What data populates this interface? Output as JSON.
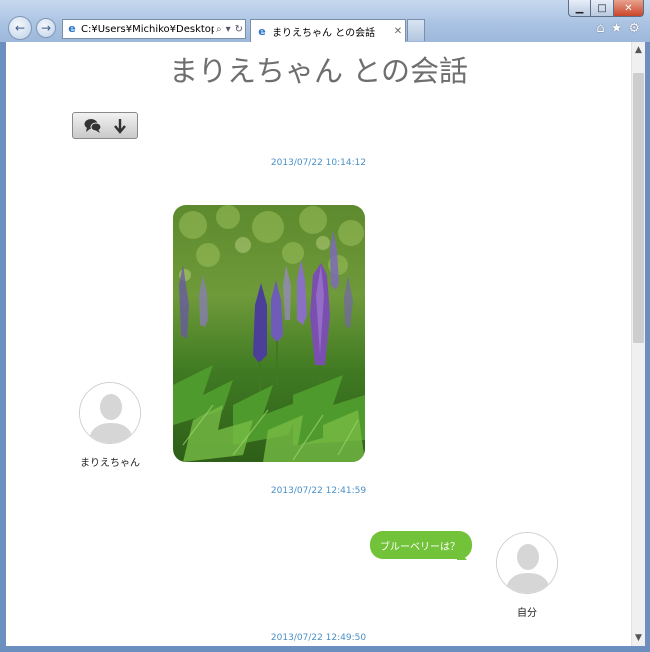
{
  "browser": {
    "address": "C:¥Users¥Michiko¥Desktop¥",
    "tab_title": "まりえちゃん との会話"
  },
  "page": {
    "title": "まりえちゃん との会話"
  },
  "messages": {
    "timestamps": [
      "2013/07/22 10:14:12",
      "2013/07/22 12:41:59",
      "2013/07/22 12:49:50"
    ],
    "contact_name": "まりえちゃん",
    "self_name": "自分",
    "sent_text": "ブルーベリーは？"
  },
  "icons": {
    "nav_back": "back-arrow-icon",
    "nav_forward": "forward-arrow-icon",
    "home": "home-icon",
    "favorites": "star-icon",
    "settings": "gear-icon",
    "chat": "speech-bubbles-icon",
    "download": "arrow-down-icon"
  },
  "colors": {
    "timestamp": "#4a90c8",
    "bubble": "#72c23a",
    "title": "#6e6e6e"
  }
}
